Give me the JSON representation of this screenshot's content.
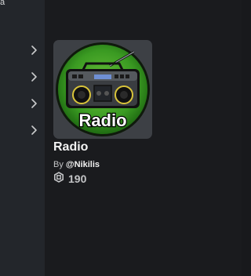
{
  "sidebar": {
    "fragment_text": "a",
    "chevrons": [
      "chevron-right-icon",
      "chevron-right-icon",
      "chevron-right-icon",
      "chevron-right-icon"
    ]
  },
  "item": {
    "thumbnail_text": "Radio",
    "name": "Radio",
    "by_prefix": "By",
    "creator": "@Nikilis",
    "currency_icon": "robux-icon",
    "price": "190"
  },
  "colors": {
    "background": "#1a1b1e",
    "sidebar": "#23262b",
    "thumbnail_bg": "#3d4045",
    "thumbnail_green": "#2f8a1e",
    "text_primary": "#f2f2f2",
    "text_secondary": "#c3c4c6"
  }
}
